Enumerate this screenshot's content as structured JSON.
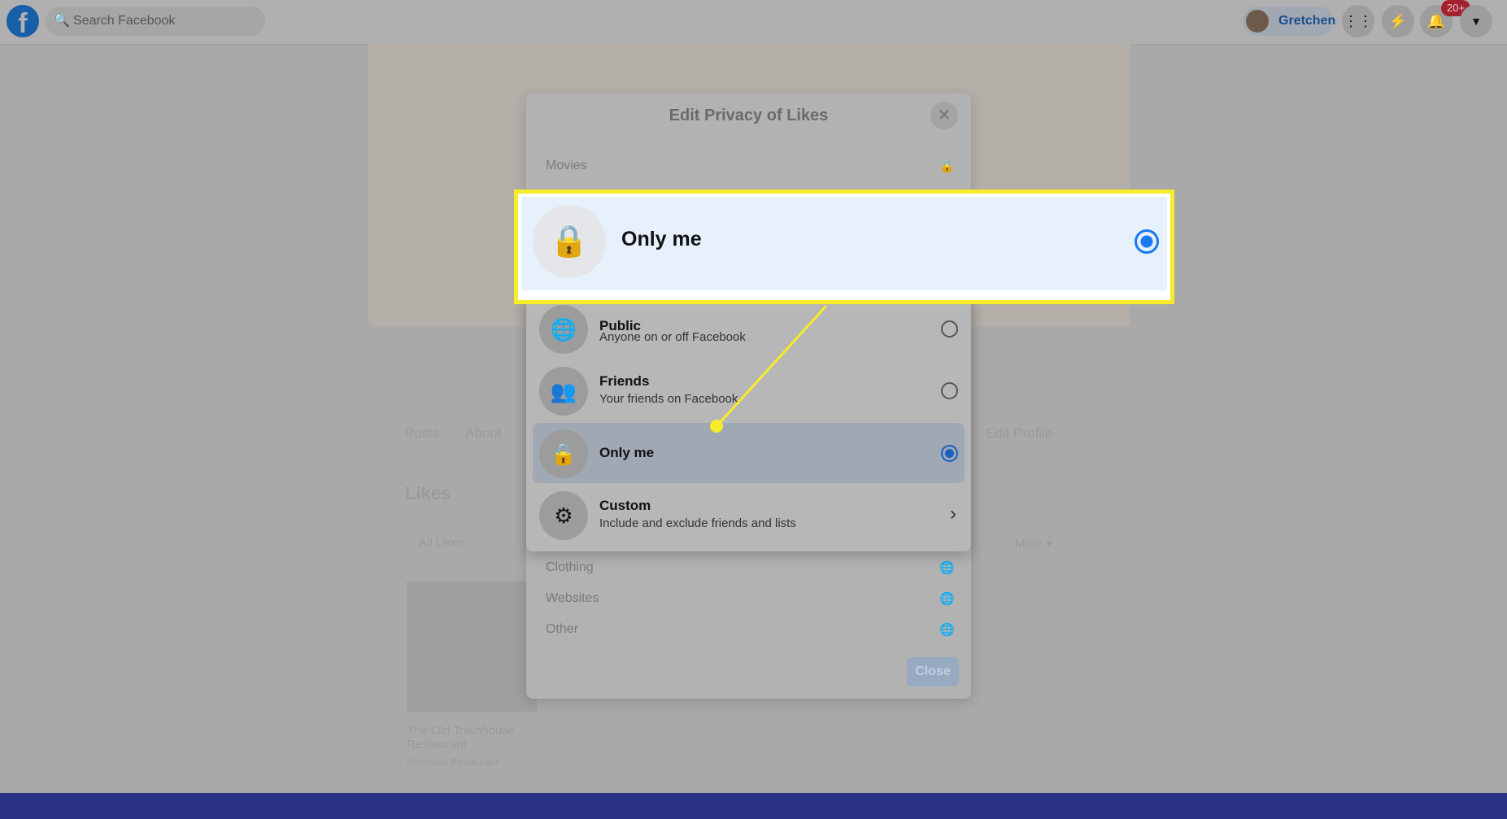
{
  "topbar": {
    "search_placeholder": "Search Facebook",
    "user_name": "Gretchen",
    "notification_badge": "20+",
    "logo": "f"
  },
  "background": {
    "tabs": [
      "Posts",
      "About"
    ],
    "edit_profile": "Edit Profile",
    "section_title": "Likes",
    "filter_tabs": [
      "All Likes",
      "More ▾"
    ],
    "card_title": "The Old Townhouse Restaurant",
    "card_subtitle": "American Restaurant"
  },
  "modal": {
    "title": "Edit Privacy of Likes",
    "categories": [
      {
        "label": "Movies",
        "icon": "lock-icon"
      },
      {
        "label": "Clothing",
        "icon": "globe-icon"
      },
      {
        "label": "Websites",
        "icon": "globe-icon"
      },
      {
        "label": "Other",
        "icon": "globe-icon"
      }
    ],
    "close_label": "Close"
  },
  "privacy_options": [
    {
      "label": "Public",
      "subtitle": "Anyone on or off Facebook",
      "icon": "globe-icon",
      "selected": false
    },
    {
      "label": "Friends",
      "subtitle": "Your friends on Facebook",
      "icon": "friends-icon",
      "selected": false
    },
    {
      "label": "Only me",
      "subtitle": "",
      "icon": "lock-icon",
      "selected": true
    },
    {
      "label": "Custom",
      "subtitle": "Include and exclude friends and lists",
      "icon": "gear-icon",
      "selected": false
    }
  ],
  "callout": {
    "label": "Only me",
    "highlight_color": "#f6ec2a"
  },
  "colors": {
    "accent": "#1877f2",
    "bottom_bar": "#2a3283"
  }
}
